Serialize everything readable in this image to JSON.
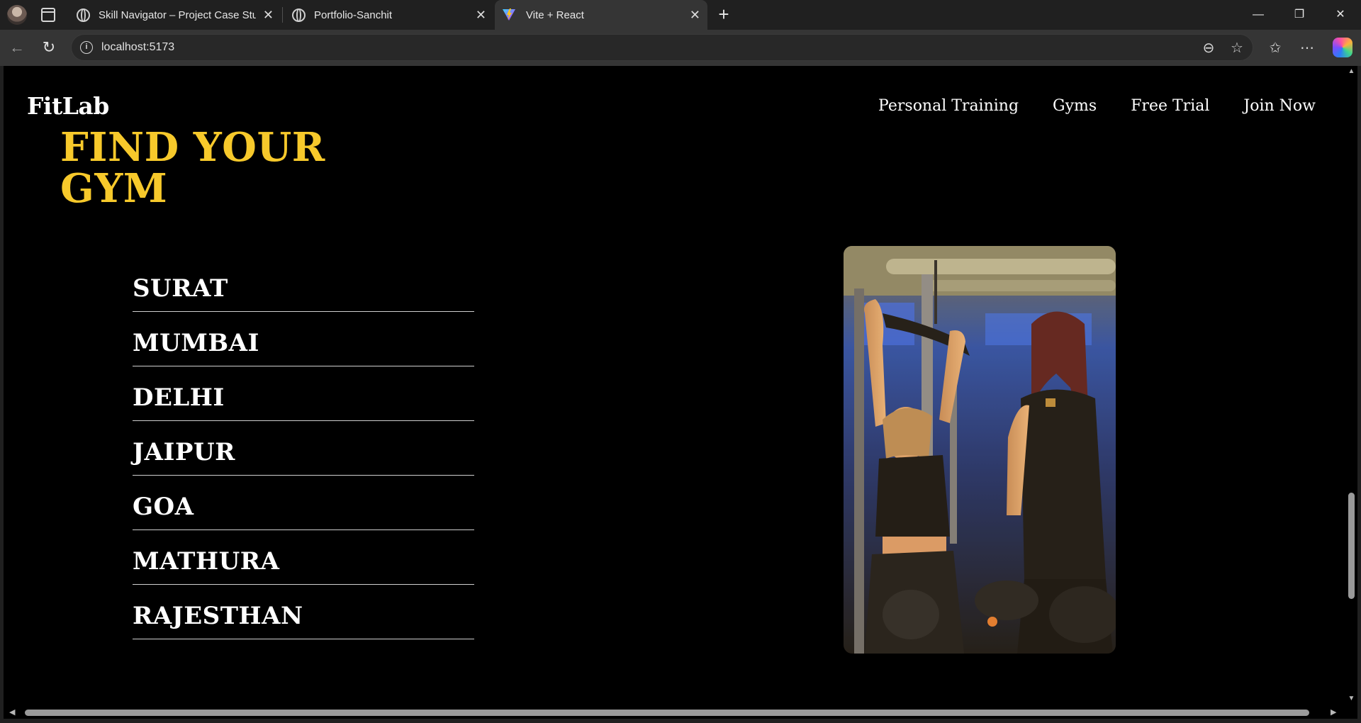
{
  "browser": {
    "tabs": [
      {
        "title": "Skill Navigator – Project Case Stuc",
        "icon": "globe-icon",
        "active": false
      },
      {
        "title": "Portfolio-Sanchit",
        "icon": "globe-icon",
        "active": false
      },
      {
        "title": "Vite + React",
        "icon": "vite-icon",
        "active": true
      }
    ],
    "url": "localhost:5173"
  },
  "site": {
    "brand": "FitLab",
    "nav": [
      {
        "label": "Personal Training"
      },
      {
        "label": "Gyms"
      },
      {
        "label": "Free Trial"
      },
      {
        "label": "Join Now"
      }
    ],
    "hero": {
      "line1": "FIND YOUR",
      "line2": "GYM"
    },
    "cities": [
      "SURAT",
      "MUMBAI",
      "DELHI",
      "JAIPUR",
      "GOA",
      "MATHURA",
      "RAJESTHAN"
    ],
    "colors": {
      "accent": "#f7c92b",
      "background": "#000000",
      "text": "#ffffff"
    }
  }
}
